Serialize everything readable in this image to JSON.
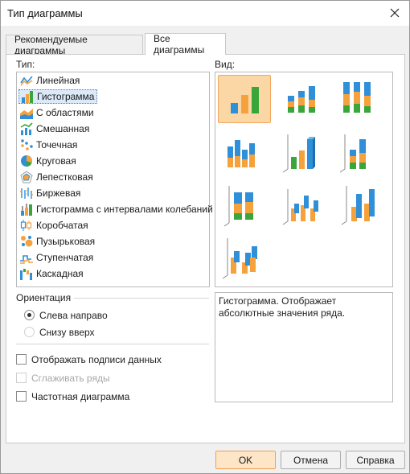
{
  "window": {
    "title": "Тип диаграммы",
    "close_icon": "close-icon"
  },
  "tabs": [
    {
      "label": "Рекомендуемые диаграммы",
      "active": false
    },
    {
      "label": "Все диаграммы",
      "active": true
    }
  ],
  "type_section": {
    "label": "Тип:",
    "items": [
      {
        "label": "Линейная",
        "icon": "line-chart-icon",
        "selected": false
      },
      {
        "label": "Гистограмма",
        "icon": "column-chart-icon",
        "selected": true
      },
      {
        "label": "С областями",
        "icon": "area-chart-icon",
        "selected": false
      },
      {
        "label": "Смешанная",
        "icon": "mixed-chart-icon",
        "selected": false
      },
      {
        "label": "Точечная",
        "icon": "scatter-chart-icon",
        "selected": false
      },
      {
        "label": "Круговая",
        "icon": "pie-chart-icon",
        "selected": false
      },
      {
        "label": "Лепестковая",
        "icon": "radar-chart-icon",
        "selected": false
      },
      {
        "label": "Биржевая",
        "icon": "stock-chart-icon",
        "selected": false
      },
      {
        "label": "Гистограмма с интервалами колебаний",
        "icon": "range-column-icon",
        "selected": false
      },
      {
        "label": "Коробчатая",
        "icon": "box-plot-icon",
        "selected": false
      },
      {
        "label": "Пузырьковая",
        "icon": "bubble-chart-icon",
        "selected": false
      },
      {
        "label": "Ступенчатая",
        "icon": "step-chart-icon",
        "selected": false
      },
      {
        "label": "Каскадная",
        "icon": "waterfall-chart-icon",
        "selected": false
      }
    ]
  },
  "view_section": {
    "label": "Вид:",
    "variants": [
      {
        "name": "clustered-column",
        "selected": true
      },
      {
        "name": "stacked-column",
        "selected": false
      },
      {
        "name": "100-stacked-column",
        "selected": false
      },
      {
        "name": "stacked-column-cylinder",
        "selected": false
      },
      {
        "name": "3d-clustered-column",
        "selected": false
      },
      {
        "name": "3d-stacked-column",
        "selected": false
      },
      {
        "name": "3d-100-stacked-column",
        "selected": false
      },
      {
        "name": "3d-clustered-column-alt",
        "selected": false
      },
      {
        "name": "3d-column",
        "selected": false
      },
      {
        "name": "3d-column-depth",
        "selected": false
      }
    ]
  },
  "description": "Гистограмма. Отображает абсолютные значения ряда.",
  "orientation": {
    "label": "Ориентация",
    "options": [
      {
        "label": "Слева направо",
        "checked": true,
        "disabled": false
      },
      {
        "label": "Снизу вверх",
        "checked": false,
        "disabled": true
      }
    ]
  },
  "checkboxes": [
    {
      "label": "Отображать подписи данных",
      "checked": false,
      "disabled": false
    },
    {
      "label": "Сглаживать ряды",
      "checked": false,
      "disabled": true
    },
    {
      "label": "Частотная диаграмма",
      "checked": false,
      "disabled": false
    }
  ],
  "buttons": {
    "ok": "OK",
    "cancel": "Отмена",
    "help": "Справка"
  },
  "colors": {
    "blue": "#2f8fd8",
    "orange": "#f5a23c",
    "green": "#3aa53a",
    "selection": "#fbd7a6"
  }
}
